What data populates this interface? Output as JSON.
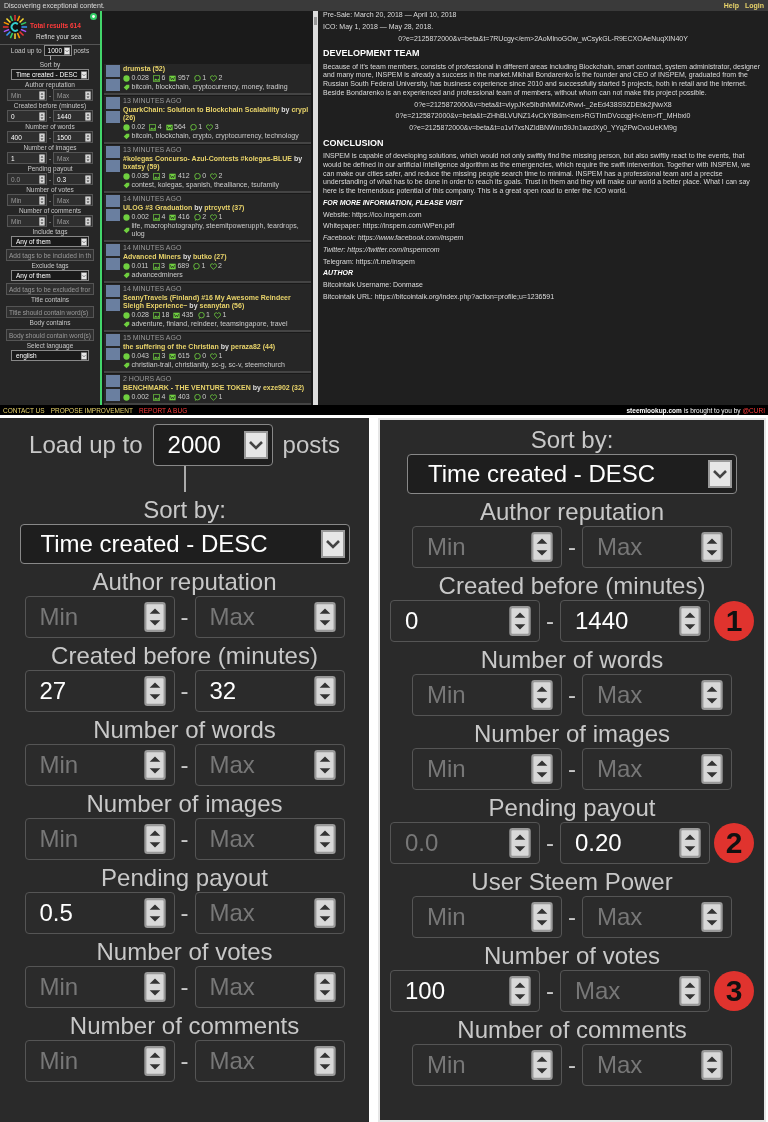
{
  "top_bar": {
    "tagline": "Discovering exceptional content.",
    "links": [
      "Help",
      "Login"
    ]
  },
  "sidebar": {
    "results": "Total results 614",
    "refine": "Refine your sea",
    "filters": [
      {
        "kind": "load",
        "before": "Load up to",
        "value": "1000",
        "after": "posts"
      },
      {
        "kind": "select",
        "label": "Sort by",
        "value": "Time created - DESC"
      },
      {
        "kind": "range",
        "label": "Author reputation",
        "min": {
          "placeholder": "Min"
        },
        "separator": "-",
        "max": {
          "placeholder": "Max"
        }
      },
      {
        "kind": "range",
        "label": "Created before (minutes)",
        "min": {
          "value": "0"
        },
        "separator": "-",
        "max": {
          "value": "1440"
        }
      },
      {
        "kind": "range",
        "label": "Number of words",
        "min": {
          "value": "400"
        },
        "separator": "-",
        "max": {
          "value": "1500"
        }
      },
      {
        "kind": "range",
        "label": "Number of images",
        "min": {
          "value": "1"
        },
        "separator": "-",
        "max": {
          "placeholder": "Max"
        }
      },
      {
        "kind": "range",
        "label": "Pending payout",
        "min": {
          "placeholder": "0.0"
        },
        "separator": "-",
        "max": {
          "value": "0.3"
        }
      },
      {
        "kind": "range",
        "label": "Number of votes",
        "min": {
          "placeholder": "Min"
        },
        "separator": "-",
        "max": {
          "placeholder": "Max"
        }
      },
      {
        "kind": "range",
        "label": "Number of comments",
        "min": {
          "placeholder": "Min"
        },
        "separator": "-",
        "max": {
          "placeholder": "Max"
        }
      },
      {
        "kind": "select",
        "label": "Include tags",
        "value": "Any of them"
      },
      {
        "kind": "text",
        "placeholder": "Add tags to be included in th"
      },
      {
        "kind": "select",
        "label": "Exclude tags",
        "value": "Any of them"
      },
      {
        "kind": "text",
        "placeholder": "Add tags to be excluded fror"
      },
      {
        "kind": "text",
        "label": "Title contains",
        "placeholder": "Title should contain word(s)"
      },
      {
        "kind": "text",
        "label": "Body contains",
        "placeholder": "Body should contain word(s)"
      },
      {
        "kind": "select",
        "label": "Select language",
        "value": "english"
      }
    ]
  },
  "posts": [
    {
      "author": "drumsta (52)",
      "payout": "0.028",
      "images": "6",
      "words": "957",
      "comments": "1",
      "votes": "2",
      "tags": "bitcoin, blockchain, cryptocurrency, money, trading"
    },
    {
      "time": "13 MINUTES AGO",
      "title": "QuarkChain: Solution to Blockchain Scalability",
      "by": "by",
      "author": "crypl (26)",
      "payout": "0.02",
      "images": "4",
      "words": "564",
      "comments": "1",
      "votes": "3",
      "tags": "bitcoin, blockchain, crypto, cryptocurrency, technology"
    },
    {
      "time": "13 MINUTES AGO",
      "title": "#kolegas Concurso- Azul-Contests #kolegas-BLUE",
      "by": "by",
      "author": "bxatsy (59)",
      "payout": "0.035",
      "images": "3",
      "words": "412",
      "comments": "0",
      "votes": "2",
      "tags": "contest, kolegas, spanish, thealliance, tsufamily"
    },
    {
      "time": "14 MINUTES AGO",
      "title": "ULOG #3 Graduation",
      "by": "by",
      "author": "ptrcyvtt (37)",
      "payout": "0.002",
      "images": "4",
      "words": "416",
      "comments": "2",
      "votes": "1",
      "tags": "life, macrophotography, steemitpowerupph, teardrops, ulog"
    },
    {
      "time": "14 MINUTES AGO",
      "title": "Advanced Miners",
      "by": "by",
      "author": "butko (27)",
      "payout": "0.011",
      "images": "3",
      "words": "689",
      "comments": "1",
      "votes": "2",
      "tags": "advancedminers"
    },
    {
      "time": "14 MINUTES AGO",
      "title": "SeanyTravels (Finland) #16 My Awesome Reindeer Sleigh Experience~",
      "by": "by",
      "author": "seanytan (56)",
      "payout": "0.028",
      "images": "18",
      "words": "435",
      "comments": "1",
      "votes": "1",
      "tags": "adventure, finland, reindeer, teamsingapore, travel"
    },
    {
      "time": "15 MINUTES AGO",
      "title": "the suffering of the Christian",
      "by": "by",
      "author": "peraza82 (44)",
      "payout": "0.043",
      "images": "3",
      "words": "615",
      "comments": "0",
      "votes": "1",
      "tags": "christian-trail, christianity, sc-g, sc-v, steemchurch"
    },
    {
      "time": "2 HOURS AGO",
      "title": "BENCHMARK - THE VENTURE TOKEN",
      "by": "by",
      "author": "exze902 (32)",
      "payout": "0.002",
      "images": "4",
      "words": "403",
      "comments": "0",
      "votes": "1"
    }
  ],
  "article": [
    {
      "kind": "text",
      "text": "Pre-Sale: March 20, 2018 — April 10, 2018"
    },
    {
      "kind": "text",
      "text": "ICO: May 1, 2018 — May 28, 2018."
    },
    {
      "kind": "center",
      "text": "0?e=2125872000&v=beta&t=7RUcgy</em>2AoMlnoGOw_wCsykGL-R9ECXOAeNuqXlN40Y"
    },
    {
      "kind": "heading",
      "text": "DEVELOPMENT TEAM"
    },
    {
      "kind": "text",
      "text": "Because of it's team members, consists of professional in different areas including Blockchain, smart contract, system administrator, designer and many more, INSPEM is already a success in the market.Mikhail Bondarenko is the founder and CEO of INSPEM, graduated from the Russian South Federal University, has business experience since 2010 and successfully started 5 projects, both in retail and the Internet. Beside Bondarenko is an experienced and professional team of members, without whom can not make this project possible."
    },
    {
      "kind": "center",
      "text": "0?e=2125872000&v=beta&t=vlypJKe5lbdhMMiZvRwvl-_2eEd438S9ZDEbk2jNwX8"
    },
    {
      "kind": "center",
      "text": "0?e=2125872000&v=beta&t=ZHhBLVUNZ14vCkYl8dm<em>RGTImDVccqgH</em>fT_MHbxi0"
    },
    {
      "kind": "center",
      "text": "0?e=2125872000&v=beta&t=o1vI7xsNZldBNWnn59Jn1wzdXy0_YYq2PwCvoUeKM9g"
    },
    {
      "kind": "heading",
      "text": "CONCLUSION"
    },
    {
      "kind": "text",
      "text": "INSPEM is capable of developing solutions, which would not only swiftly find the missing person, but also swiftly react to the events, that would be defined in our artificial intelligence algorithm as the emergencies, which require the swift intervention. Together with INSPEM, we can make our cities safer, and reduce the missing people search time to minimal. INSPEM has a professional team and a precise understanding of what has to be done in order to reach its goals. Trust in them and they will make our world a better place. What I can say here is the tremendous potential of this company. This is a great open road to enter the ICO world."
    },
    {
      "kind": "subheading",
      "text": "FOR MORE INFORMATION, PLEASE VISIT"
    },
    {
      "kind": "text",
      "text": "Website: https://ico.inspem.com"
    },
    {
      "kind": "text",
      "text": "Whitepaper: https://inspem.com/WPen.pdf"
    },
    {
      "kind": "italic",
      "text": "Facebook: https://www.facebook.com/inspem"
    },
    {
      "kind": "italic",
      "text": "Twitter: https://twitter.com/inspemcom"
    },
    {
      "kind": "text",
      "text": "Telegram: https://t.me/inspem"
    },
    {
      "kind": "subheading",
      "text": "AUTHOR"
    },
    {
      "kind": "text",
      "text": "Bitcointalk Username: Donmase"
    },
    {
      "kind": "text",
      "text": "Bitcointalk URL: https://bitcointalk.org/index.php?action=profile;u=1236591"
    }
  ],
  "footer": {
    "links": [
      {
        "text": "CONTACT US",
        "kind": "normal"
      },
      {
        "text": "PROPOSE IMPROVEMENT",
        "kind": "normal"
      },
      {
        "text": "REPORT A BUG",
        "kind": "alert"
      }
    ],
    "site": "steemlookup.com",
    "credit": "is brought to you by",
    "handle": "@CURI"
  },
  "zoom_left": {
    "filters": [
      {
        "kind": "load",
        "before": "Load up to",
        "value": "2000",
        "after": "posts"
      },
      {
        "kind": "select",
        "label": "Sort by:",
        "value": "Time created - DESC"
      },
      {
        "kind": "range",
        "label": "Author reputation",
        "min": {
          "placeholder": "Min"
        },
        "separator": "-",
        "max": {
          "placeholder": "Max"
        }
      },
      {
        "kind": "range",
        "label": "Created before (minutes)",
        "min": {
          "value": "27"
        },
        "separator": "-",
        "max": {
          "value": "32"
        }
      },
      {
        "kind": "range",
        "label": "Number of words",
        "min": {
          "placeholder": "Min"
        },
        "separator": "-",
        "max": {
          "placeholder": "Max"
        }
      },
      {
        "kind": "range",
        "label": "Number of images",
        "min": {
          "placeholder": "Min"
        },
        "separator": "-",
        "max": {
          "placeholder": "Max"
        }
      },
      {
        "kind": "range",
        "label": "Pending payout",
        "min": {
          "value": "0.5"
        },
        "separator": "-",
        "max": {
          "placeholder": "Max"
        }
      },
      {
        "kind": "range",
        "label": "Number of votes",
        "min": {
          "placeholder": "Min"
        },
        "separator": "-",
        "max": {
          "placeholder": "Max"
        }
      },
      {
        "kind": "range",
        "label": "Number of comments",
        "min": {
          "placeholder": "Min"
        },
        "separator": "-",
        "max": {
          "placeholder": "Max"
        }
      }
    ]
  },
  "zoom_right": {
    "filters": [
      {
        "kind": "select",
        "label": "Sort by:",
        "value": "Time created - DESC"
      },
      {
        "kind": "range",
        "label": "Author reputation",
        "min": {
          "placeholder": "Min"
        },
        "separator": "-",
        "max": {
          "placeholder": "Max"
        }
      },
      {
        "kind": "range",
        "label": "Created before (minutes)",
        "min": {
          "value": "0"
        },
        "separator": "-",
        "max": {
          "value": "1440"
        },
        "badge": "1"
      },
      {
        "kind": "range",
        "label": "Number of words",
        "min": {
          "placeholder": "Min"
        },
        "separator": "-",
        "max": {
          "placeholder": "Max"
        }
      },
      {
        "kind": "range",
        "label": "Number of images",
        "min": {
          "placeholder": "Min"
        },
        "separator": "-",
        "max": {
          "placeholder": "Max"
        }
      },
      {
        "kind": "range",
        "label": "Pending payout",
        "min": {
          "placeholder": "0.0"
        },
        "separator": "-",
        "max": {
          "value": "0.20"
        },
        "badge": "2"
      },
      {
        "kind": "range",
        "label": "User Steem Power",
        "min": {
          "placeholder": "Min"
        },
        "separator": "-",
        "max": {
          "placeholder": "Max"
        }
      },
      {
        "kind": "range",
        "label": "Number of votes",
        "min": {
          "value": "100"
        },
        "separator": "-",
        "max": {
          "placeholder": "Max"
        },
        "badge": "3"
      },
      {
        "kind": "range",
        "label": "Number of comments",
        "min": {
          "placeholder": "Min"
        },
        "separator": "-",
        "max": {
          "placeholder": "Max"
        }
      }
    ]
  }
}
